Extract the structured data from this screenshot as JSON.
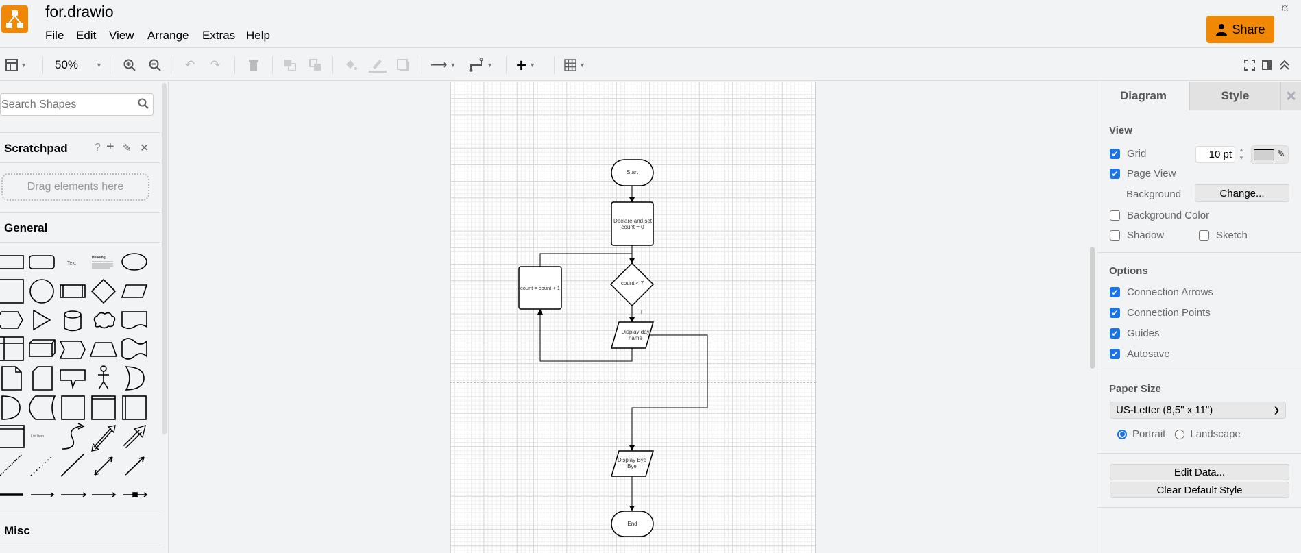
{
  "app": {
    "title": "for.drawio",
    "menu": [
      "File",
      "Edit",
      "View",
      "Arrange",
      "Extras",
      "Help"
    ],
    "share_label": "Share",
    "brand_color": "#f08705"
  },
  "toolbar": {
    "zoom": "50%"
  },
  "sidebar": {
    "search_placeholder": "Search Shapes",
    "scratchpad": "Scratchpad",
    "scratch_help": "?",
    "scratch_add": "+",
    "drag_hint": "Drag elements here",
    "general": "General",
    "misc": "Misc",
    "shape_text": "Text",
    "shape_heading": "Heading",
    "shape_list_item": "List Item"
  },
  "diagram": {
    "start": "Start",
    "declare": "Declare and set count = 0",
    "cond": "count < 7",
    "true_label": "T",
    "increment": "count = count + 1",
    "display_day": "Display day name",
    "display_bye": "Display Bye Bye",
    "end": "End"
  },
  "panel": {
    "tabs": [
      "Diagram",
      "Style"
    ],
    "view_header": "View",
    "grid": "Grid",
    "grid_size": "10 pt",
    "page_view": "Page View",
    "background": "Background",
    "change": "Change...",
    "background_color": "Background Color",
    "shadow": "Shadow",
    "sketch": "Sketch",
    "options_header": "Options",
    "connection_arrows": "Connection Arrows",
    "connection_points": "Connection Points",
    "guides": "Guides",
    "autosave": "Autosave",
    "paper_header": "Paper Size",
    "paper_size": "US-Letter (8,5\" x 11\")",
    "portrait": "Portrait",
    "landscape": "Landscape",
    "edit_data": "Edit Data...",
    "clear_style": "Clear Default Style",
    "checks": {
      "grid": true,
      "page_view": true,
      "background_color": false,
      "shadow": false,
      "sketch": false,
      "connection_arrows": true,
      "connection_points": true,
      "guides": true,
      "autosave": true
    },
    "orientation": "portrait",
    "accent": "#1a73e8"
  }
}
